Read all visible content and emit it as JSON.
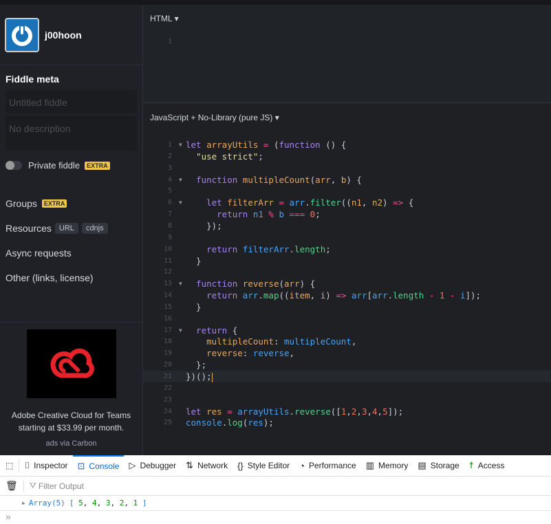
{
  "user": {
    "name": "j00hoon"
  },
  "sidebar": {
    "meta_title": "Fiddle meta",
    "title_placeholder": "Untitled fiddle",
    "desc_placeholder": "No description",
    "private_label": "Private fiddle",
    "extra": "EXTRA",
    "groups": "Groups",
    "resources": "Resources",
    "url": "URL",
    "cdnjs": "cdnjs",
    "async": "Async requests",
    "other": "Other (links, license)"
  },
  "ad": {
    "line1": "Adobe Creative Cloud for Teams",
    "line2": "starting at $33.99 per month.",
    "via": "ads via Carbon"
  },
  "html_pane": {
    "title": "HTML",
    "lines": [
      "1"
    ]
  },
  "js_pane": {
    "title": "JavaScript + No-Library (pure JS)",
    "active_line": 21,
    "folds": [
      1,
      4,
      6,
      13,
      17
    ],
    "lines": [
      [
        [
          "kw",
          "let "
        ],
        [
          "id",
          "arrayUtils"
        ],
        [
          "op",
          " = "
        ],
        [
          "p",
          "("
        ],
        [
          "kw",
          "function"
        ],
        [
          "p",
          " () {"
        ]
      ],
      [
        [
          "str",
          "  \"use strict\""
        ],
        [
          "p",
          ";"
        ]
      ],
      [],
      [
        [
          "kw",
          "  function "
        ],
        [
          "id",
          "multipleCount"
        ],
        [
          "p",
          "("
        ],
        [
          "id",
          "arr"
        ],
        [
          "p",
          ", "
        ],
        [
          "id",
          "b"
        ],
        [
          "p",
          ") {"
        ]
      ],
      [],
      [
        [
          "kw",
          "    let "
        ],
        [
          "id",
          "filterArr"
        ],
        [
          "op",
          " = "
        ],
        [
          "var",
          "arr"
        ],
        [
          "p",
          "."
        ],
        [
          "prop",
          "filter"
        ],
        [
          "p",
          "(("
        ],
        [
          "id",
          "n1"
        ],
        [
          "p",
          ", "
        ],
        [
          "id",
          "n2"
        ],
        [
          "p",
          ") "
        ],
        [
          "op",
          "=>"
        ],
        [
          "p",
          " {"
        ]
      ],
      [
        [
          "kw",
          "      return "
        ],
        [
          "var",
          "n1"
        ],
        [
          "op",
          " % "
        ],
        [
          "var",
          "b"
        ],
        [
          "op",
          " === "
        ],
        [
          "num0",
          "0"
        ],
        [
          "p",
          ";"
        ]
      ],
      [
        [
          "p",
          "    });"
        ]
      ],
      [],
      [
        [
          "kw",
          "    return "
        ],
        [
          "var",
          "filterArr"
        ],
        [
          "p",
          "."
        ],
        [
          "prop",
          "length"
        ],
        [
          "p",
          ";"
        ]
      ],
      [
        [
          "p",
          "  }"
        ]
      ],
      [],
      [
        [
          "kw",
          "  function "
        ],
        [
          "id",
          "reverse"
        ],
        [
          "p",
          "("
        ],
        [
          "id",
          "arr"
        ],
        [
          "p",
          ") {"
        ]
      ],
      [
        [
          "kw",
          "    return "
        ],
        [
          "var",
          "arr"
        ],
        [
          "p",
          "."
        ],
        [
          "prop",
          "map"
        ],
        [
          "p",
          "(("
        ],
        [
          "id",
          "item"
        ],
        [
          "p",
          ", "
        ],
        [
          "id",
          "i"
        ],
        [
          "p",
          ") "
        ],
        [
          "op",
          "=>"
        ],
        [
          "var",
          " arr"
        ],
        [
          "p",
          "["
        ],
        [
          "var",
          "arr"
        ],
        [
          "p",
          "."
        ],
        [
          "prop",
          "length"
        ],
        [
          "op",
          " - "
        ],
        [
          "num0",
          "1"
        ],
        [
          "op",
          " - "
        ],
        [
          "var",
          "i"
        ],
        [
          "p",
          "]);"
        ]
      ],
      [
        [
          "p",
          "  }"
        ]
      ],
      [],
      [
        [
          "kw",
          "  return "
        ],
        [
          "p",
          "{"
        ]
      ],
      [
        [
          "id",
          "    multipleCount"
        ],
        [
          "p",
          ": "
        ],
        [
          "var",
          "multipleCount"
        ],
        [
          "p",
          ","
        ]
      ],
      [
        [
          "id",
          "    reverse"
        ],
        [
          "p",
          ": "
        ],
        [
          "var",
          "reverse"
        ],
        [
          "p",
          ","
        ]
      ],
      [
        [
          "p",
          "  };"
        ]
      ],
      [
        [
          "p",
          "})();"
        ]
      ],
      [],
      [],
      [
        [
          "kw",
          "let "
        ],
        [
          "id",
          "res"
        ],
        [
          "op",
          " = "
        ],
        [
          "var",
          "arrayUtils"
        ],
        [
          "p",
          "."
        ],
        [
          "prop",
          "reverse"
        ],
        [
          "p",
          "(["
        ],
        [
          "num0",
          "1"
        ],
        [
          "p",
          ","
        ],
        [
          "num0",
          "2"
        ],
        [
          "p",
          ","
        ],
        [
          "num0",
          "3"
        ],
        [
          "p",
          ","
        ],
        [
          "num0",
          "4"
        ],
        [
          "p",
          ","
        ],
        [
          "num0",
          "5"
        ],
        [
          "p",
          "]);"
        ]
      ],
      [
        [
          "var",
          "console"
        ],
        [
          "p",
          "."
        ],
        [
          "prop",
          "log"
        ],
        [
          "p",
          "("
        ],
        [
          "var",
          "res"
        ],
        [
          "p",
          ");"
        ]
      ]
    ]
  },
  "devtools": {
    "tabs": [
      {
        "icon": "inspector-icon",
        "glyph": "⌷",
        "label": "Inspector"
      },
      {
        "icon": "console-icon",
        "glyph": "⊡",
        "label": "Console"
      },
      {
        "icon": "debugger-icon",
        "glyph": "▷",
        "label": "Debugger"
      },
      {
        "icon": "network-icon",
        "glyph": "⇅",
        "label": "Network"
      },
      {
        "icon": "style-editor-icon",
        "glyph": "{}",
        "label": "Style Editor"
      },
      {
        "icon": "performance-icon",
        "glyph": "◔",
        "label": "Performance"
      },
      {
        "icon": "memory-icon",
        "glyph": "▥",
        "label": "Memory"
      },
      {
        "icon": "storage-icon",
        "glyph": "▤",
        "label": "Storage"
      },
      {
        "icon": "accessibility-icon",
        "glyph": "☨",
        "label": "Access"
      }
    ],
    "selected_tab": "Console",
    "filter_placeholder": "Filter Output",
    "output": {
      "type": "Array(5)",
      "values": [
        "5",
        "4",
        "3",
        "2",
        "1"
      ]
    }
  },
  "colors": {
    "accent": "#0a84ff",
    "extra_badge": "#f0c445",
    "avatar": "#1a73b8"
  }
}
